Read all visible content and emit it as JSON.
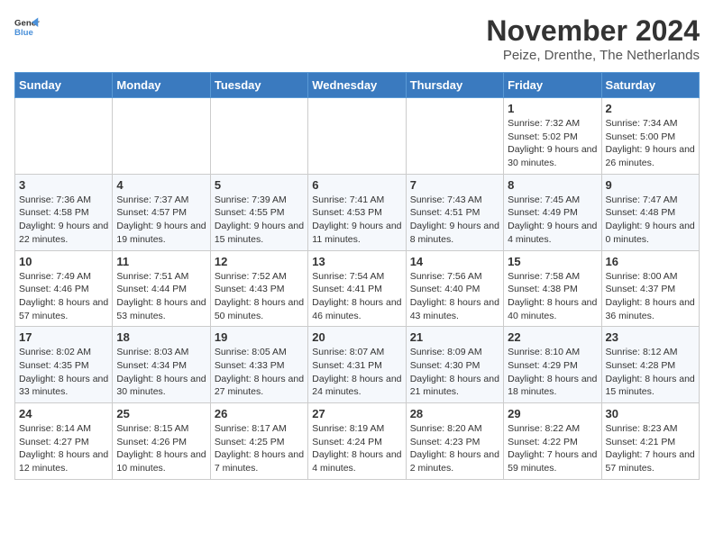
{
  "logo": {
    "line1": "General",
    "line2": "Blue"
  },
  "title": "November 2024",
  "location": "Peize, Drenthe, The Netherlands",
  "weekdays": [
    "Sunday",
    "Monday",
    "Tuesday",
    "Wednesday",
    "Thursday",
    "Friday",
    "Saturday"
  ],
  "weeks": [
    [
      {
        "day": "",
        "info": ""
      },
      {
        "day": "",
        "info": ""
      },
      {
        "day": "",
        "info": ""
      },
      {
        "day": "",
        "info": ""
      },
      {
        "day": "",
        "info": ""
      },
      {
        "day": "1",
        "info": "Sunrise: 7:32 AM\nSunset: 5:02 PM\nDaylight: 9 hours and 30 minutes."
      },
      {
        "day": "2",
        "info": "Sunrise: 7:34 AM\nSunset: 5:00 PM\nDaylight: 9 hours and 26 minutes."
      }
    ],
    [
      {
        "day": "3",
        "info": "Sunrise: 7:36 AM\nSunset: 4:58 PM\nDaylight: 9 hours and 22 minutes."
      },
      {
        "day": "4",
        "info": "Sunrise: 7:37 AM\nSunset: 4:57 PM\nDaylight: 9 hours and 19 minutes."
      },
      {
        "day": "5",
        "info": "Sunrise: 7:39 AM\nSunset: 4:55 PM\nDaylight: 9 hours and 15 minutes."
      },
      {
        "day": "6",
        "info": "Sunrise: 7:41 AM\nSunset: 4:53 PM\nDaylight: 9 hours and 11 minutes."
      },
      {
        "day": "7",
        "info": "Sunrise: 7:43 AM\nSunset: 4:51 PM\nDaylight: 9 hours and 8 minutes."
      },
      {
        "day": "8",
        "info": "Sunrise: 7:45 AM\nSunset: 4:49 PM\nDaylight: 9 hours and 4 minutes."
      },
      {
        "day": "9",
        "info": "Sunrise: 7:47 AM\nSunset: 4:48 PM\nDaylight: 9 hours and 0 minutes."
      }
    ],
    [
      {
        "day": "10",
        "info": "Sunrise: 7:49 AM\nSunset: 4:46 PM\nDaylight: 8 hours and 57 minutes."
      },
      {
        "day": "11",
        "info": "Sunrise: 7:51 AM\nSunset: 4:44 PM\nDaylight: 8 hours and 53 minutes."
      },
      {
        "day": "12",
        "info": "Sunrise: 7:52 AM\nSunset: 4:43 PM\nDaylight: 8 hours and 50 minutes."
      },
      {
        "day": "13",
        "info": "Sunrise: 7:54 AM\nSunset: 4:41 PM\nDaylight: 8 hours and 46 minutes."
      },
      {
        "day": "14",
        "info": "Sunrise: 7:56 AM\nSunset: 4:40 PM\nDaylight: 8 hours and 43 minutes."
      },
      {
        "day": "15",
        "info": "Sunrise: 7:58 AM\nSunset: 4:38 PM\nDaylight: 8 hours and 40 minutes."
      },
      {
        "day": "16",
        "info": "Sunrise: 8:00 AM\nSunset: 4:37 PM\nDaylight: 8 hours and 36 minutes."
      }
    ],
    [
      {
        "day": "17",
        "info": "Sunrise: 8:02 AM\nSunset: 4:35 PM\nDaylight: 8 hours and 33 minutes."
      },
      {
        "day": "18",
        "info": "Sunrise: 8:03 AM\nSunset: 4:34 PM\nDaylight: 8 hours and 30 minutes."
      },
      {
        "day": "19",
        "info": "Sunrise: 8:05 AM\nSunset: 4:33 PM\nDaylight: 8 hours and 27 minutes."
      },
      {
        "day": "20",
        "info": "Sunrise: 8:07 AM\nSunset: 4:31 PM\nDaylight: 8 hours and 24 minutes."
      },
      {
        "day": "21",
        "info": "Sunrise: 8:09 AM\nSunset: 4:30 PM\nDaylight: 8 hours and 21 minutes."
      },
      {
        "day": "22",
        "info": "Sunrise: 8:10 AM\nSunset: 4:29 PM\nDaylight: 8 hours and 18 minutes."
      },
      {
        "day": "23",
        "info": "Sunrise: 8:12 AM\nSunset: 4:28 PM\nDaylight: 8 hours and 15 minutes."
      }
    ],
    [
      {
        "day": "24",
        "info": "Sunrise: 8:14 AM\nSunset: 4:27 PM\nDaylight: 8 hours and 12 minutes."
      },
      {
        "day": "25",
        "info": "Sunrise: 8:15 AM\nSunset: 4:26 PM\nDaylight: 8 hours and 10 minutes."
      },
      {
        "day": "26",
        "info": "Sunrise: 8:17 AM\nSunset: 4:25 PM\nDaylight: 8 hours and 7 minutes."
      },
      {
        "day": "27",
        "info": "Sunrise: 8:19 AM\nSunset: 4:24 PM\nDaylight: 8 hours and 4 minutes."
      },
      {
        "day": "28",
        "info": "Sunrise: 8:20 AM\nSunset: 4:23 PM\nDaylight: 8 hours and 2 minutes."
      },
      {
        "day": "29",
        "info": "Sunrise: 8:22 AM\nSunset: 4:22 PM\nDaylight: 7 hours and 59 minutes."
      },
      {
        "day": "30",
        "info": "Sunrise: 8:23 AM\nSunset: 4:21 PM\nDaylight: 7 hours and 57 minutes."
      }
    ]
  ]
}
